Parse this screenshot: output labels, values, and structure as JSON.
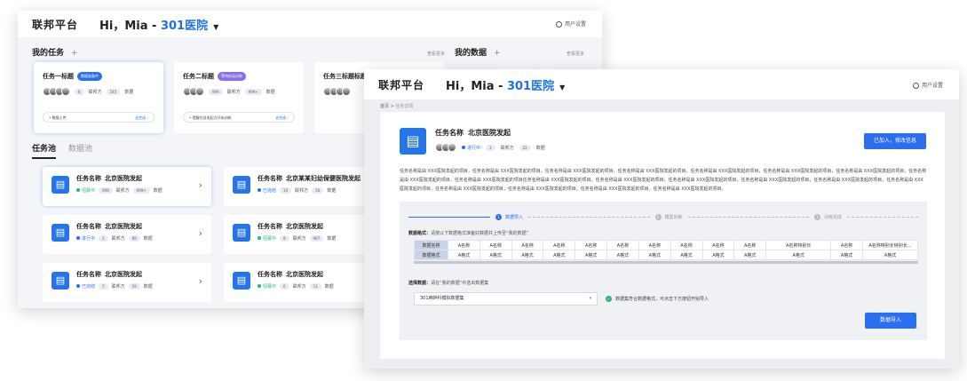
{
  "back": {
    "logo": "联邦平台",
    "greeting_prefix": "Hi，Mia - ",
    "hospital": "301医院",
    "user_settings": "用户设置",
    "my_tasks": "我的任务",
    "my_tasks_more": "查看更多",
    "my_data": "我的数据",
    "my_data_more": "查看更多",
    "task_cards": [
      {
        "title": "任务一标题",
        "badge": "数据准备中",
        "count": "8",
        "unit": "联邦方",
        "data_count": "245",
        "data_label": "数据",
        "footer": "• 数据上传",
        "footer_link": "去完成 ›"
      },
      {
        "title": "任务二标题",
        "badge": "等待启动训练",
        "count": "999",
        "unit": "联邦方",
        "data_count": "999+",
        "data_label": "数据",
        "footer": "• 提醒任务发起方开始训练",
        "footer_link": "去完成 ›"
      },
      {
        "title": "任务三标题标题",
        "badge": "",
        "count": "",
        "unit": "",
        "data_count": "",
        "data_label": "",
        "footer": "",
        "footer_link": ""
      }
    ],
    "tabs": [
      "任务池",
      "数据池"
    ],
    "pool_cards": [
      {
        "label": "任务名称",
        "name": "北京医院发起",
        "status": "招募中",
        "status_color": "#27b873",
        "count": "999",
        "unit": "联邦方",
        "data_count": "999+",
        "data_label": "数据"
      },
      {
        "label": "任务名称",
        "name": "北京某某妇幼保健医院发起",
        "status": "已完结",
        "status_color": "#2b6ef0",
        "count": "10",
        "unit": "联邦方",
        "data_count": "56",
        "data_label": "数据"
      },
      {
        "label": "任务名称",
        "name": "北京医院发起",
        "status": "进行中",
        "status_color": "#2b6ef0",
        "count": "3",
        "unit": "联邦方",
        "data_count": "89",
        "data_label": "数据"
      },
      {
        "label": "任务名称",
        "name": "北京医院发起",
        "status": "招募中",
        "status_color": "#27b873",
        "count": "8",
        "unit": "联邦方",
        "data_count": "987",
        "data_label": "数据"
      },
      {
        "label": "任务名称",
        "name": "北京医院发起",
        "status": "已完结",
        "status_color": "#2b6ef0",
        "count": "7",
        "unit": "联邦方",
        "data_count": "59",
        "data_label": "数据"
      },
      {
        "label": "任务名称",
        "name": "北京医院发起",
        "status": "招募中",
        "status_color": "#27b873",
        "count": "6",
        "unit": "联邦方",
        "data_count": "12",
        "data_label": "数据"
      }
    ]
  },
  "front": {
    "logo": "联邦平台",
    "greeting_prefix": "Hi，Mia - ",
    "hospital": "301医院",
    "user_settings": "用户设置",
    "breadcrumb_home": "首页",
    "breadcrumb_sep": " > ",
    "breadcrumb_current": "任务详情",
    "task_label": "任务名称",
    "task_name": "北京医院发起",
    "status": "进行中",
    "count": "3",
    "unit": "联邦方",
    "data_count": "22",
    "data_label": "数据",
    "joined_button": "已加入，修改信息",
    "description": "任务名称是由 XXX医院发起的项目，任务名称是由 XXX医院发起的项目，任务名称是由 XXX医院发起的项目，任务名称是由 XXX医院发起的项目，任务名称是由 XXX医院发起的项目，任务名称是由 XXX医院发起的项目，任务名称是由 XXX医院发起的项目，任务名称是由 XXX医院发起的项目，任务名称是由 XXX医院发起的项目任务名称是由 XXX医院发起的项目，任务名称是由 XXX医院发起的项目，任务名称是由 XXX医院发起的项目，任务名称是由 XXX医院发起的项目，任务名称是由 XXX医院发起的项目，任务名称是由 XXX医院发起的项目，任务名称是由 XXX医院发起的项目，任务名称是由 XXX医院发起的项目，任务名称是由 XXX医院发起的项目，任务名称是由 XXX医院发起的项目。",
    "steps": [
      {
        "num": "1",
        "label": "数据导入"
      },
      {
        "num": "2",
        "label": "模型训练"
      },
      {
        "num": "3",
        "label": "训练完成"
      }
    ],
    "format_label": "数据格式：",
    "format_hint": "请按以下数据格式准备好数据并上传至“我的数据”",
    "table_row_headers": [
      "数据名称",
      "数据格式"
    ],
    "table_names": [
      "A名称",
      "A名称",
      "A名称",
      "A名称",
      "A名称",
      "A名称",
      "A名称",
      "A名称",
      "A名称",
      "A名称",
      "A名称特别长",
      "A名称",
      "A名称特别长特别长..."
    ],
    "table_formats": [
      "A格式",
      "A格式",
      "A格式",
      "A格式",
      "A格式",
      "A格式",
      "A格式",
      "A格式",
      "A格式",
      "A格式",
      "A格式",
      "A格式",
      "A格式"
    ],
    "select_label": "选择数据：",
    "select_hint": "请在“我的数据”中选出数据集",
    "select_value": "301麻醉科模拟数据集",
    "ok_message": "数据集符合数据格式，可点击下方按钮开始导入",
    "import_button": "数据导入"
  }
}
